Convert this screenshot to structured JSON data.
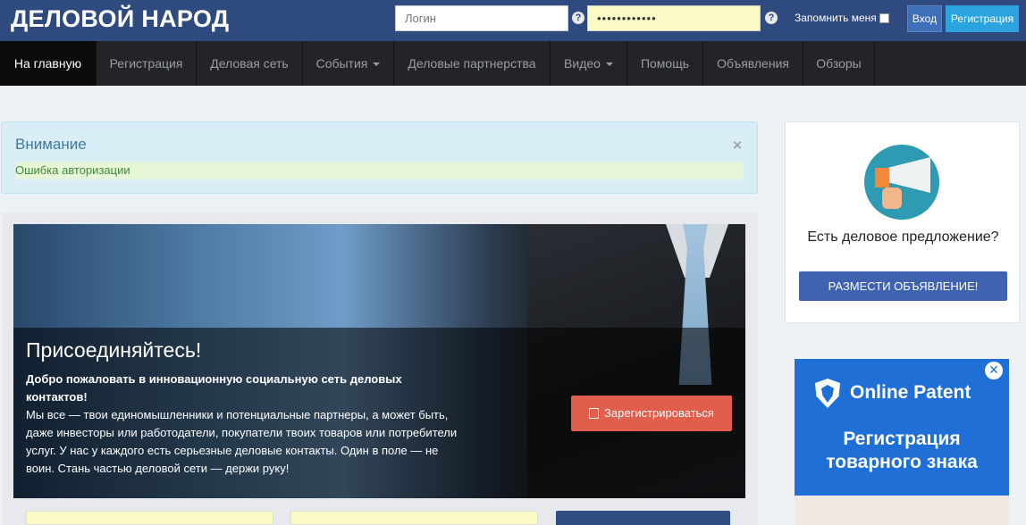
{
  "header": {
    "logo": "ДЕЛОВОЙ НАРОД",
    "login_placeholder": "Логин",
    "password_value": "••••••••••••",
    "help_glyph": "?",
    "remember_label": "Запомнить меня",
    "login_button": "Вход",
    "register_button": "Регистрация"
  },
  "nav": {
    "items": [
      {
        "label": "На главную",
        "active": true
      },
      {
        "label": "Регистрация"
      },
      {
        "label": "Деловая сеть"
      },
      {
        "label": "События",
        "dropdown": true
      },
      {
        "label": "Деловые партнерства"
      },
      {
        "label": "Видео",
        "dropdown": true
      },
      {
        "label": "Помощь"
      },
      {
        "label": "Объявления"
      },
      {
        "label": "Обзоры"
      }
    ]
  },
  "alert": {
    "title": "Внимание",
    "close": "×",
    "message": "Ошибка авторизации"
  },
  "hero": {
    "title": "Присоединяйтесь!",
    "bold_text": "Добро пожаловать в инновационную социальную сеть деловых контактов!",
    "text": "Мы все — твои единомышленники и потенциальные партнеры, а может быть, даже инвесторы или работодатели, покупатели твоих товаров или потребители услуг. У нас у каждого есть серьезные деловые контакты. Один в поле — не воин. Стань частью деловой сети — держи руку!",
    "button": "Зарегистрироваться"
  },
  "sidebar": {
    "question": "Есть деловое предложение?",
    "button": "РАЗМЕСТИ ОБЪЯВЛЕНИЕ!",
    "icon": "megaphone-icon"
  },
  "ad": {
    "close": "✕",
    "brand": "Online Patent",
    "text": "Регистрация товарного знака"
  },
  "colors": {
    "header_bg": "#2e4a7f",
    "nav_bg": "#222429",
    "accent_blue": "#3f63b0",
    "register_cyan": "#2aa3de",
    "hero_button": "#e15d4c",
    "ad_blue": "#1f6fd6"
  }
}
